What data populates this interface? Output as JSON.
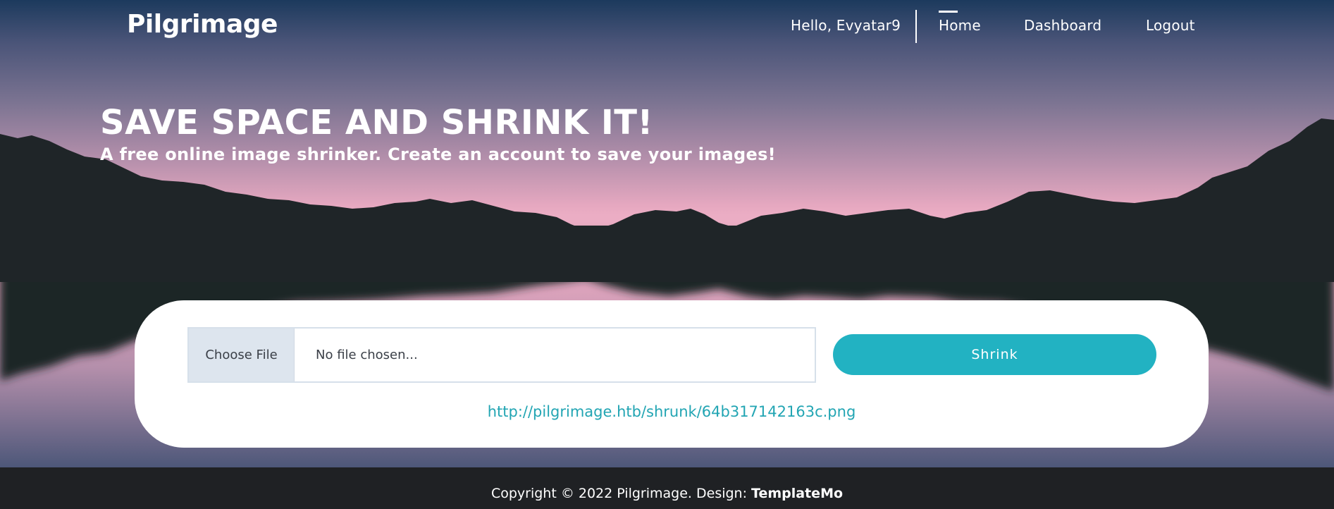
{
  "nav": {
    "brand": "Pilgrimage",
    "greeting": "Hello, Evyatar9",
    "links": [
      "Home",
      "Dashboard",
      "Logout"
    ],
    "active": "Home"
  },
  "hero": {
    "title": "SAVE SPACE AND SHRINK IT!",
    "subtitle": "A free online image shrinker. Create an account to save your images!"
  },
  "upload": {
    "choose_label": "Choose File",
    "file_status": "No file chosen...",
    "submit_label": "Shrink",
    "result_url": "http://pilgrimage.htb/shrunk/64b317142163c.png"
  },
  "footer": {
    "copyright": "Copyright © 2022 Pilgrimage. Design: ",
    "designer": "TemplateMo"
  },
  "colors": {
    "accent": "#22b2c2",
    "link": "#22a5b3",
    "footer_bg": "#1f2124",
    "mountain": "#1f2528"
  }
}
